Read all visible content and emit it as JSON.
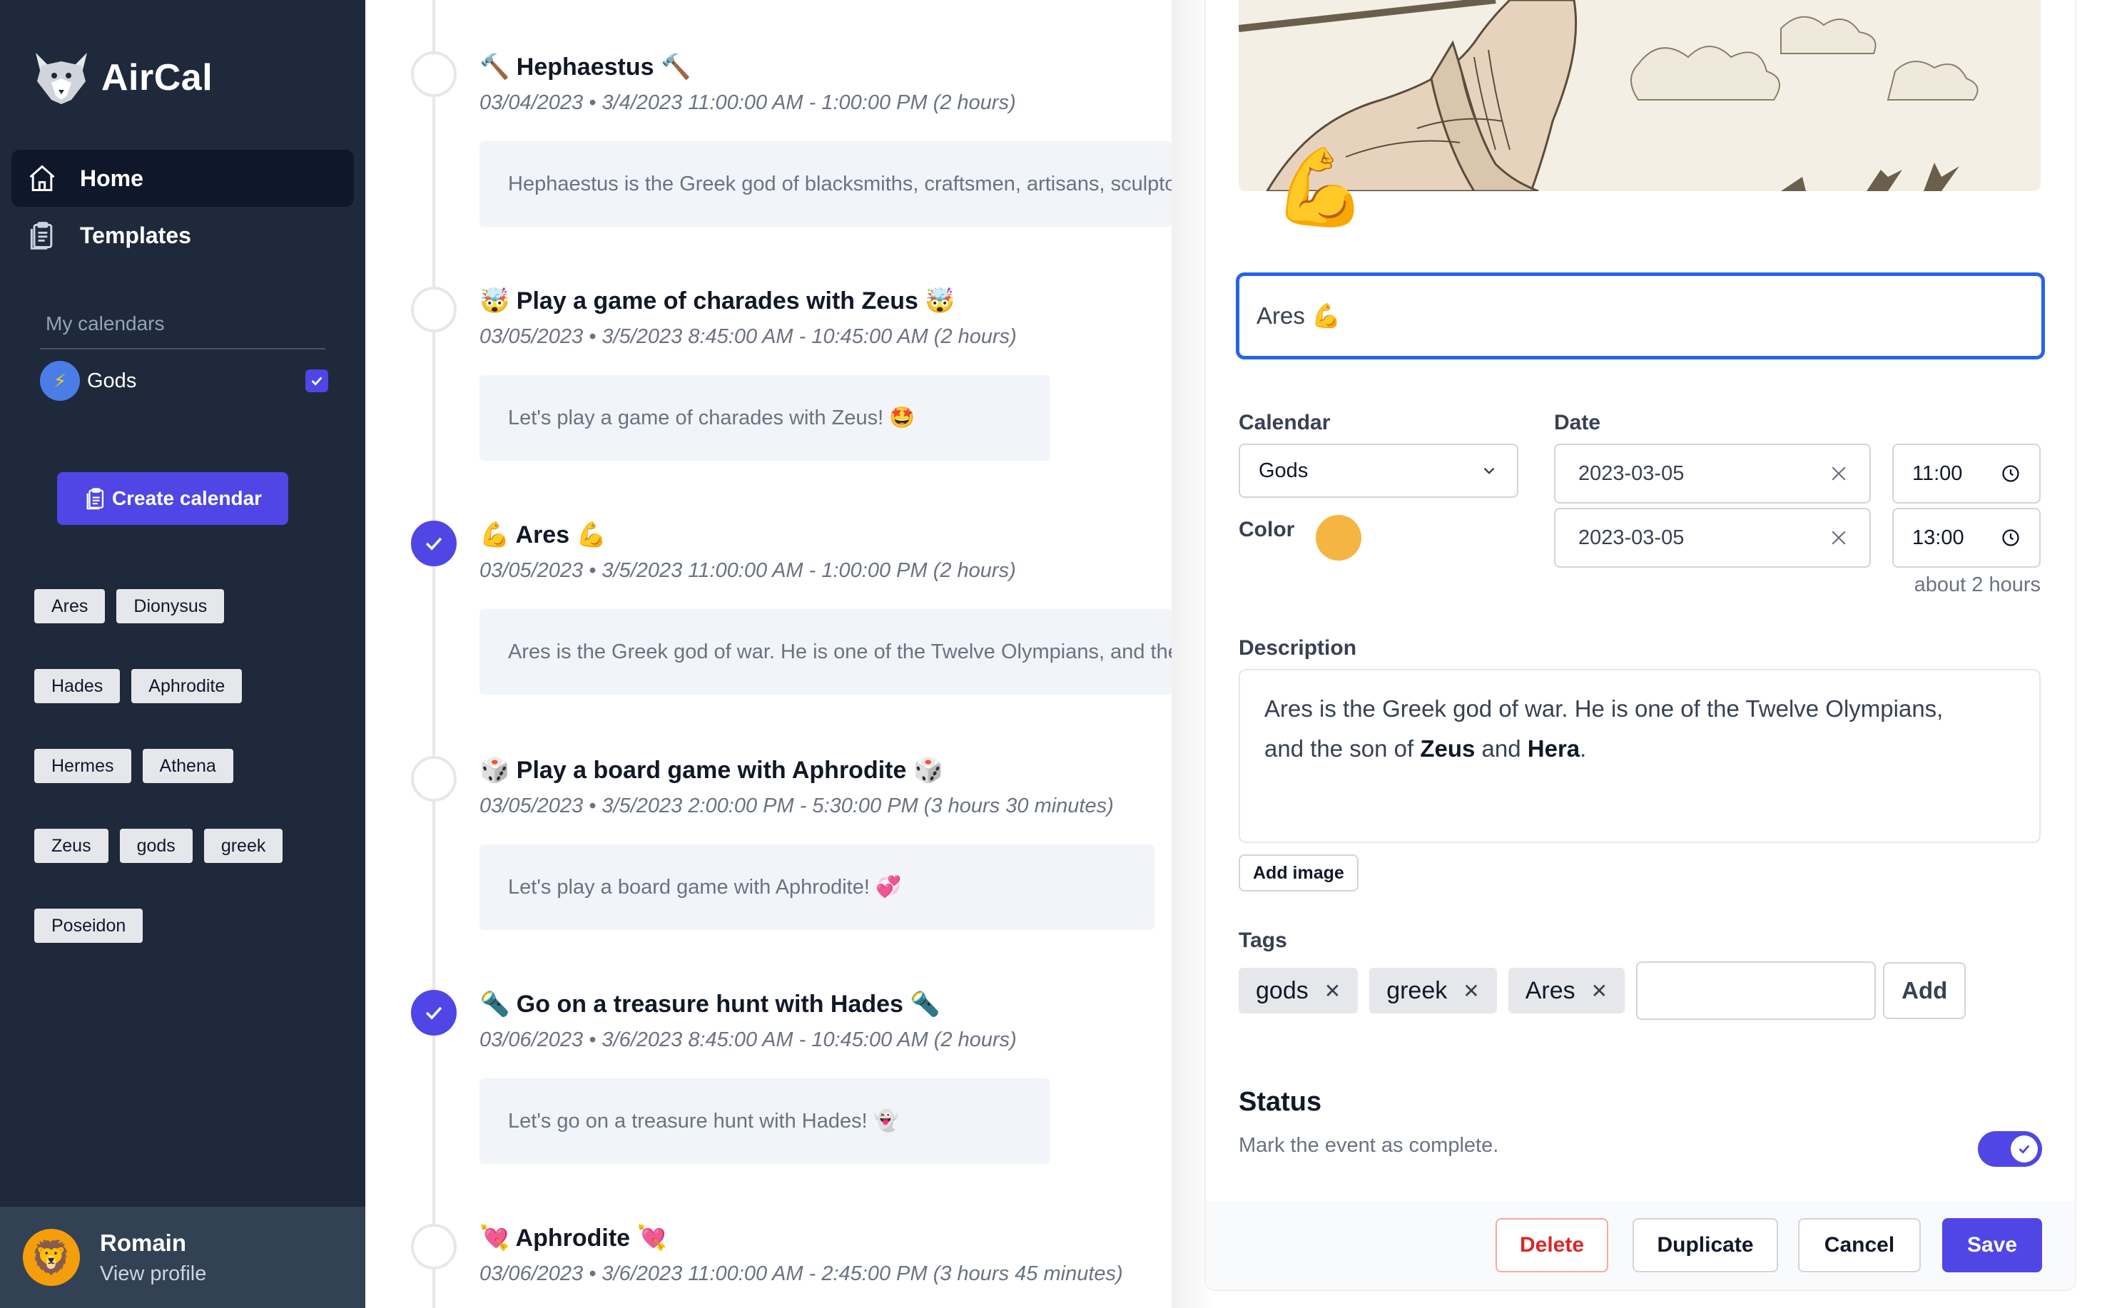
{
  "app": {
    "name": "AirCal"
  },
  "nav": {
    "home": "Home",
    "templates": "Templates"
  },
  "calendars": {
    "section_title": "My calendars",
    "items": [
      {
        "name": "Gods",
        "checked": true,
        "color": "#4a7ee6"
      }
    ],
    "create_label": "Create calendar"
  },
  "tag_cloud": [
    "Ares",
    "Dionysus",
    "Hades",
    "Aphrodite",
    "Hermes",
    "Athena",
    "Zeus",
    "gods",
    "greek",
    "Poseidon"
  ],
  "profile": {
    "name": "Romain",
    "link": "View profile"
  },
  "timeline": [
    {
      "title": "🔨 Hephaestus 🔨",
      "date": "03/04/2023 • 3/4/2023 11:00:00 AM - 1:00:00 PM (2 hours)",
      "description": "Hephaestus is the Greek god of blacksmiths, craftsmen, artisans, sculptors",
      "done": false
    },
    {
      "title": "🤯 Play a game of charades with Zeus 🤯",
      "date": "03/05/2023 • 3/5/2023 8:45:00 AM - 10:45:00 AM (2 hours)",
      "description": "Let's play a game of charades with Zeus! 🤩",
      "done": false
    },
    {
      "title": "💪 Ares 💪",
      "date": "03/05/2023 • 3/5/2023 11:00:00 AM - 1:00:00 PM (2 hours)",
      "description": "Ares is the Greek god of war. He is one of the Twelve Olympians, and the son",
      "done": true
    },
    {
      "title": "🎲 Play a board game with Aphrodite 🎲",
      "date": "03/05/2023 • 3/5/2023 2:00:00 PM - 5:30:00 PM (3 hours 30 minutes)",
      "description": "Let's play a board game with Aphrodite! 💞",
      "done": false
    },
    {
      "title": "🔦 Go on a treasure hunt with Hades 🔦",
      "date": "03/06/2023 • 3/6/2023 8:45:00 AM - 10:45:00 AM (2 hours)",
      "description": "Let's go on a treasure hunt with Hades! 👻",
      "done": true
    },
    {
      "title": "💘 Aphrodite 💘",
      "date": "03/06/2023 • 3/6/2023 11:00:00 AM - 2:45:00 PM (3 hours 45 minutes)",
      "description": "",
      "done": false
    }
  ],
  "editor": {
    "emoji": "💪",
    "title_value": "Ares 💪",
    "calendar_label": "Calendar",
    "calendar_value": "Gods",
    "color_label": "Color",
    "color": "#f5b542",
    "date_label": "Date",
    "start_date": "2023-03-05",
    "end_date": "2023-03-05",
    "start_time": "11:00",
    "end_time": "13:00",
    "duration": "about 2 hours",
    "description_label": "Description",
    "description_line1": "Ares is the Greek god of war. He is one of the Twelve Olympians,",
    "description_pre": "and the son of ",
    "description_zeus": "Zeus",
    "description_and": " and ",
    "description_hera": "Hera",
    "description_end": ".",
    "add_image": "Add image",
    "tags_label": "Tags",
    "tags": [
      "gods",
      "greek",
      "Ares"
    ],
    "tag_input_value": "",
    "tag_add": "Add",
    "status_title": "Status",
    "status_sub": "Mark the event as complete.",
    "status_complete": true
  },
  "footer": {
    "delete": "Delete",
    "duplicate": "Duplicate",
    "cancel": "Cancel",
    "save": "Save"
  }
}
